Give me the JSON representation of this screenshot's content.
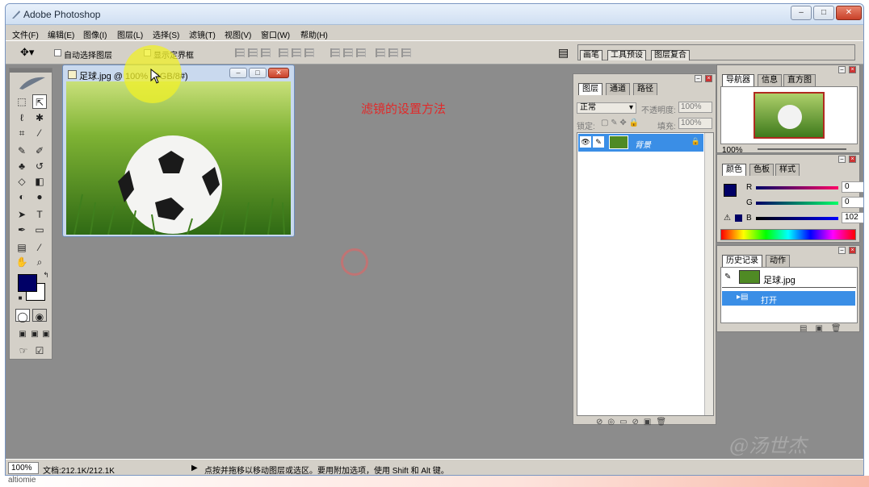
{
  "app": {
    "title": "Adobe Photoshop",
    "window_buttons": [
      "–",
      "□",
      "✕"
    ]
  },
  "menubar": [
    "文件(F)",
    "编辑(E)",
    "图像(I)",
    "图层(L)",
    "选择(S)",
    "滤镜(T)",
    "视图(V)",
    "窗口(W)",
    "帮助(H)"
  ],
  "options_bar": {
    "auto_select_label": "自动选择图层",
    "show_bounds_label": "显示定界框",
    "palette_well_tabs": [
      "画笔",
      "工具预设",
      "图层复合"
    ]
  },
  "document": {
    "title": "足球.jpg @ 100% (RGB/8#)",
    "window_buttons": [
      "–",
      "□",
      "✕"
    ]
  },
  "overlay_title": "滤镜的设置方法",
  "layers_palette": {
    "tabs": [
      "图层",
      "通道",
      "路径"
    ],
    "blend_mode": "正常",
    "opacity_label": "不透明度:",
    "opacity_value": "100%",
    "lock_label": "锁定:",
    "fill_label": "填充:",
    "fill_value": "100%",
    "layer_name": "背景"
  },
  "navigator_palette": {
    "tabs": [
      "导航器",
      "信息",
      "直方图"
    ],
    "zoom": "100%"
  },
  "color_palette": {
    "tabs": [
      "颜色",
      "色板",
      "样式"
    ],
    "channels": [
      {
        "label": "R",
        "value": "0"
      },
      {
        "label": "G",
        "value": "0"
      },
      {
        "label": "B",
        "value": "102"
      }
    ],
    "foreground_color": "#000066"
  },
  "history_palette": {
    "tabs": [
      "历史记录",
      "动作"
    ],
    "snapshot_label": "足球.jpg",
    "items": [
      "打开"
    ]
  },
  "statusbar": {
    "zoom": "100%",
    "doc_info": "文档:212.1K/212.1K",
    "hint": "点按并拖移以移动图层或选区。要用附加选项，使用 Shift 和 Alt 键。"
  },
  "watermark": "@汤世杰",
  "bottom_strip_text": "altiomie",
  "colors": {
    "selection_blue": "#3a8ee6",
    "workspace_gray": "#8c8c8c",
    "overlay_red": "#e02a2a"
  }
}
